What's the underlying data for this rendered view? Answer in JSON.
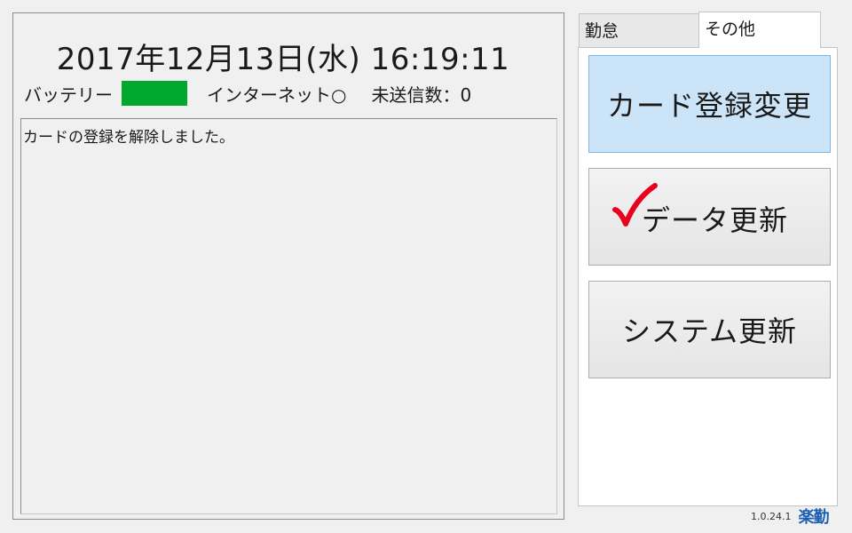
{
  "clock": {
    "datetime": "2017年12月13日(水) 16:19:11"
  },
  "status": {
    "battery_label": "バッテリー",
    "battery_color": "#00a82d",
    "internet_label": "インターネット○",
    "unsent_label": "未送信数：0"
  },
  "message": {
    "text": "カードの登録を解除しました。"
  },
  "tabs": [
    {
      "label": "勤怠",
      "active": false
    },
    {
      "label": "その他",
      "active": true
    }
  ],
  "buttons": {
    "card_register": "カード登録変更",
    "data_update": "データ更新",
    "system_update": "システム更新"
  },
  "icons": {
    "data_update_check": "check-icon",
    "check_color": "#e8001c"
  },
  "footer": {
    "version": "1.0.24.1",
    "logo": "楽勤"
  }
}
